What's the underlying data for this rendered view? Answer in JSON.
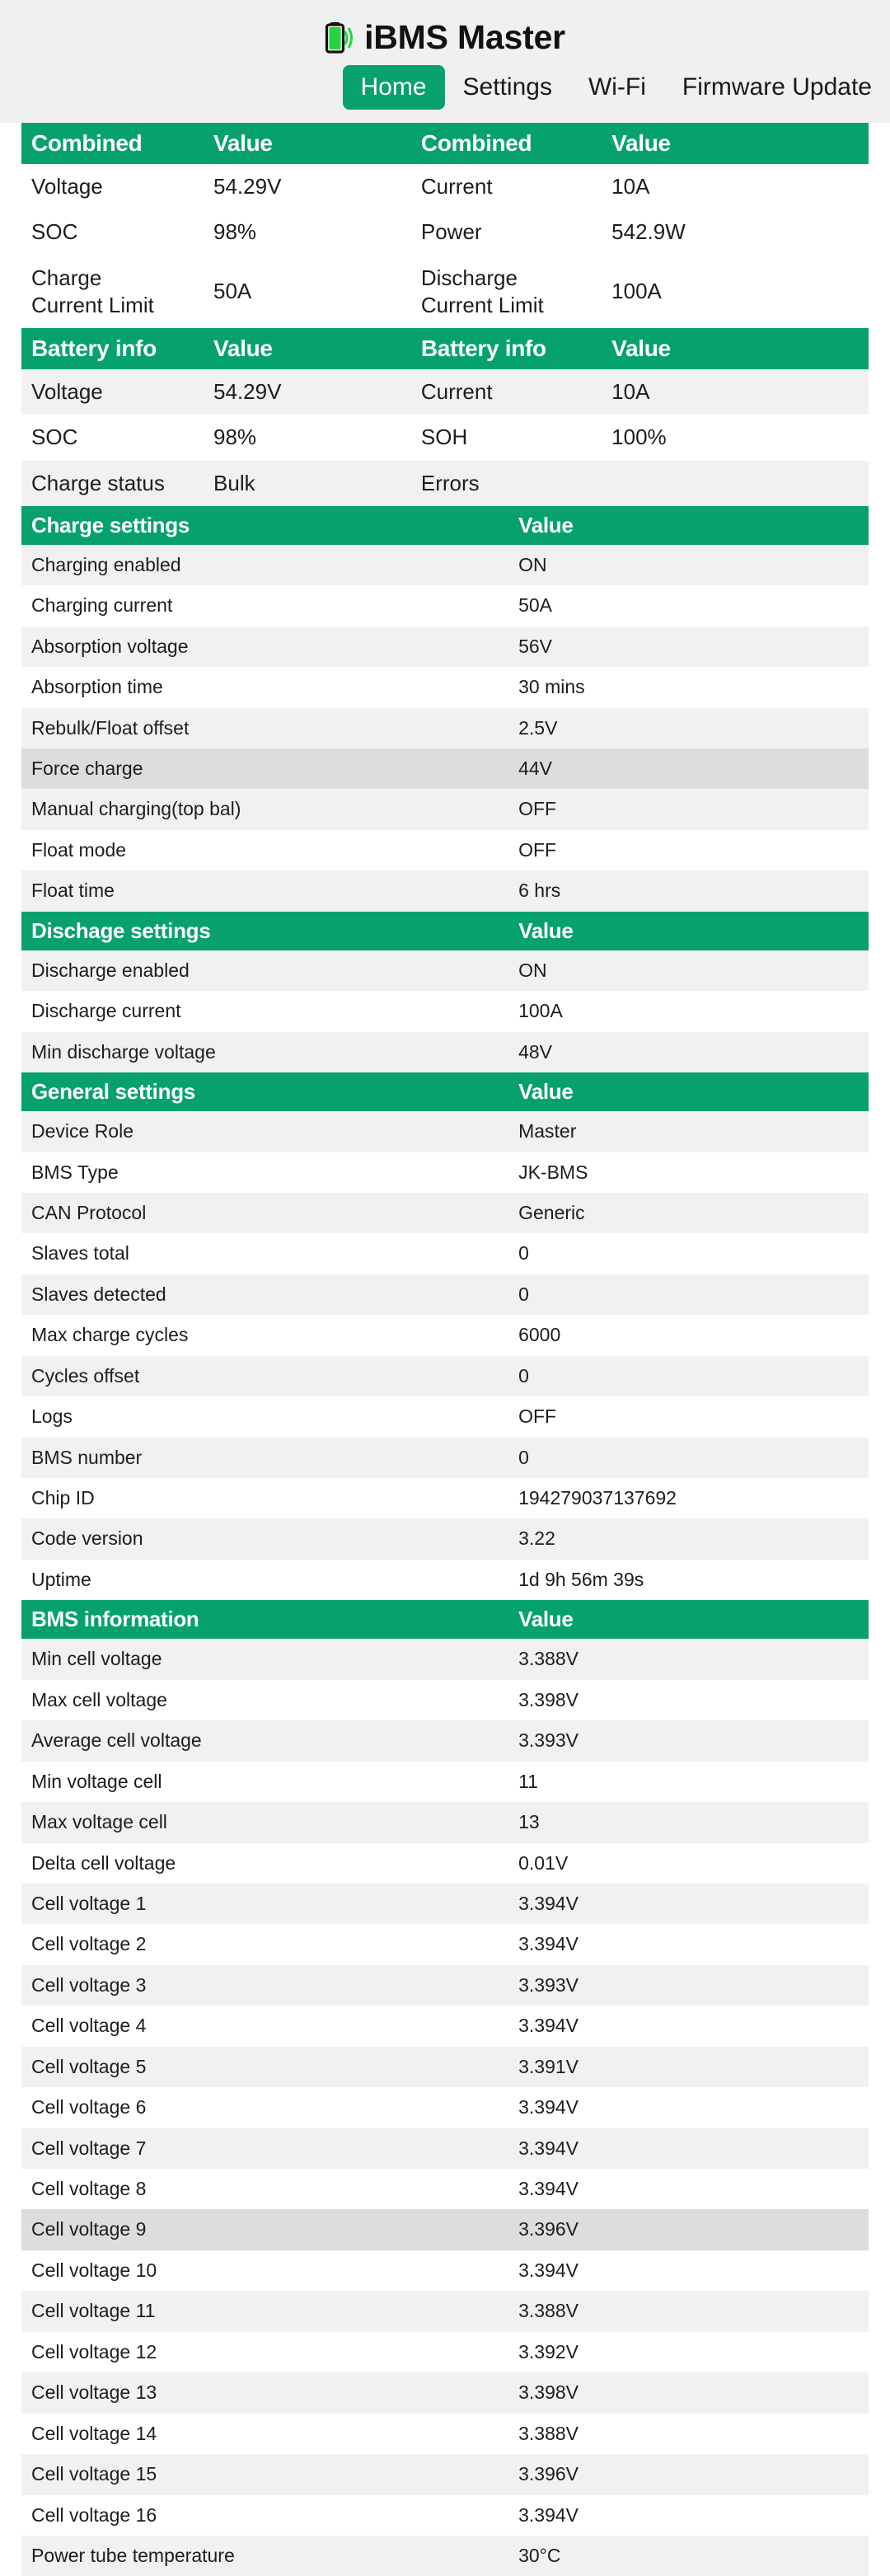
{
  "header": {
    "title": "iBMS Master",
    "icon": "battery-signal-icon",
    "accent_color": "#06a16e",
    "nav": [
      {
        "label": "Home",
        "active": true
      },
      {
        "label": "Settings",
        "active": false
      },
      {
        "label": "Wi-Fi",
        "active": false
      },
      {
        "label": "Firmware Update",
        "active": false
      }
    ]
  },
  "tables": {
    "combined": {
      "headers": [
        "Combined",
        "Value",
        "Combined",
        "Value"
      ],
      "rows": [
        [
          "Voltage",
          "54.29V",
          "Current",
          "10A"
        ],
        [
          "SOC",
          "98%",
          "Power",
          "542.9W"
        ],
        [
          "Charge\nCurrent Limit",
          "50A",
          "Discharge\nCurrent Limit",
          "100A"
        ]
      ]
    },
    "battery_info": {
      "headers": [
        "Battery info",
        "Value",
        "Battery info",
        "Value"
      ],
      "rows": [
        [
          "Voltage",
          "54.29V",
          "Current",
          "10A"
        ],
        [
          "SOC",
          "98%",
          "SOH",
          "100%"
        ],
        [
          "Charge status",
          "Bulk",
          "Errors",
          ""
        ]
      ]
    },
    "charge_settings": {
      "headers": [
        "Charge settings",
        "Value"
      ],
      "rows": [
        [
          "Charging enabled",
          "ON"
        ],
        [
          "Charging current",
          "50A"
        ],
        [
          "Absorption voltage",
          "56V"
        ],
        [
          "Absorption time",
          "30 mins"
        ],
        [
          "Rebulk/Float offset",
          "2.5V"
        ],
        [
          "Force charge",
          "44V"
        ],
        [
          "Manual charging(top bal)",
          "OFF"
        ],
        [
          "Float mode",
          "OFF"
        ],
        [
          "Float time",
          "6 hrs"
        ]
      ],
      "hover_row_index": 5
    },
    "discharge_settings": {
      "headers": [
        "Dischage settings",
        "Value"
      ],
      "rows": [
        [
          "Discharge enabled",
          "ON"
        ],
        [
          "Discharge current",
          "100A"
        ],
        [
          "Min discharge voltage",
          "48V"
        ]
      ]
    },
    "general_settings": {
      "headers": [
        "General settings",
        "Value"
      ],
      "rows": [
        [
          "Device Role",
          "Master"
        ],
        [
          "BMS Type",
          "JK-BMS"
        ],
        [
          "CAN Protocol",
          "Generic"
        ],
        [
          "Slaves total",
          "0"
        ],
        [
          "Slaves detected",
          "0"
        ],
        [
          "Max charge cycles",
          "6000"
        ],
        [
          "Cycles offset",
          "0"
        ],
        [
          "Logs",
          "OFF"
        ],
        [
          "BMS number",
          "0"
        ],
        [
          "Chip ID",
          "194279037137692"
        ],
        [
          "Code version",
          "3.22"
        ],
        [
          "Uptime",
          "1d 9h 56m 39s"
        ]
      ]
    },
    "bms_information": {
      "headers": [
        "BMS information",
        "Value"
      ],
      "rows": [
        [
          "Min cell voltage",
          "3.388V"
        ],
        [
          "Max cell voltage",
          "3.398V"
        ],
        [
          "Average cell voltage",
          "3.393V"
        ],
        [
          "Min voltage cell",
          "11"
        ],
        [
          "Max voltage cell",
          "13"
        ],
        [
          "Delta cell voltage",
          "0.01V"
        ],
        [
          "Cell voltage 1",
          "3.394V"
        ],
        [
          "Cell voltage 2",
          "3.394V"
        ],
        [
          "Cell voltage 3",
          "3.393V"
        ],
        [
          "Cell voltage 4",
          "3.394V"
        ],
        [
          "Cell voltage 5",
          "3.391V"
        ],
        [
          "Cell voltage 6",
          "3.394V"
        ],
        [
          "Cell voltage 7",
          "3.394V"
        ],
        [
          "Cell voltage 8",
          "3.394V"
        ],
        [
          "Cell voltage 9",
          "3.396V"
        ],
        [
          "Cell voltage 10",
          "3.394V"
        ],
        [
          "Cell voltage 11",
          "3.388V"
        ],
        [
          "Cell voltage 12",
          "3.392V"
        ],
        [
          "Cell voltage 13",
          "3.398V"
        ],
        [
          "Cell voltage 14",
          "3.388V"
        ],
        [
          "Cell voltage 15",
          "3.396V"
        ],
        [
          "Cell voltage 16",
          "3.394V"
        ],
        [
          "Power tube temperature",
          "30°C"
        ]
      ],
      "hover_row_index": 14
    }
  }
}
